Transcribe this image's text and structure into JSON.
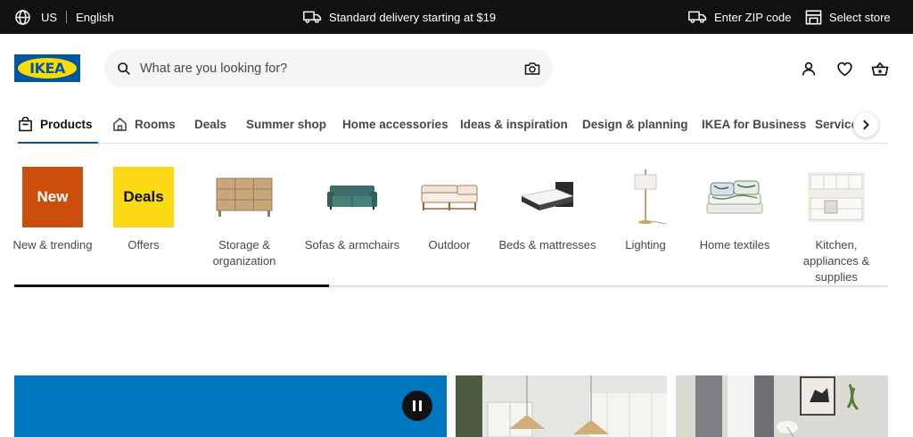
{
  "topbar": {
    "country": "US",
    "language": "English",
    "delivery": "Standard delivery starting at $19",
    "zip": "Enter ZIP code",
    "store": "Select store"
  },
  "logo": {
    "text": "IKEA"
  },
  "search": {
    "placeholder": "What are you looking for?"
  },
  "nav": {
    "tabs": [
      {
        "label": "Products"
      },
      {
        "label": "Rooms"
      },
      {
        "label": "Deals"
      },
      {
        "label": "Summer shop"
      },
      {
        "label": "Home accessories"
      },
      {
        "label": "Ideas & inspiration"
      },
      {
        "label": "Design & planning"
      },
      {
        "label": "IKEA for Business"
      },
      {
        "label": "Services & sup"
      }
    ]
  },
  "categories": [
    {
      "label": "New & trending",
      "badge": "New"
    },
    {
      "label": "Offers",
      "badge": "Deals"
    },
    {
      "label": "Storage & organization"
    },
    {
      "label": "Sofas & armchairs"
    },
    {
      "label": "Outdoor"
    },
    {
      "label": "Beds & mattresses"
    },
    {
      "label": "Lighting"
    },
    {
      "label": "Home textiles"
    },
    {
      "label": "Kitchen, appliances & supplies"
    }
  ],
  "carousel": {
    "scroll_fraction": 0.36
  },
  "colors": {
    "brand_blue": "#0058a3",
    "brand_yellow": "#ffdb00",
    "new_badge": "#cc4e0c",
    "deals_badge": "#fbd914",
    "promo_blue": "#0077c1"
  }
}
